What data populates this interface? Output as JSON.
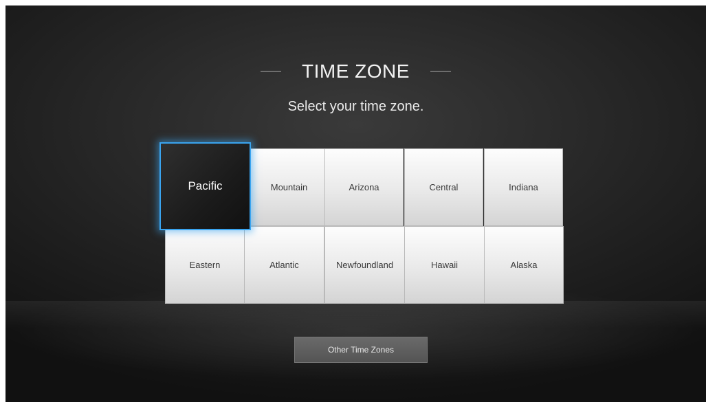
{
  "screen": {
    "title": "TIME ZONE",
    "subtitle": "Select your time zone."
  },
  "time_zones": [
    {
      "label": "Pacific",
      "selected": true
    },
    {
      "label": "Mountain",
      "selected": false
    },
    {
      "label": "Arizona",
      "selected": false
    },
    {
      "label": "Central",
      "selected": false
    },
    {
      "label": "Indiana",
      "selected": false
    },
    {
      "label": "Eastern",
      "selected": false
    },
    {
      "label": "Atlantic",
      "selected": false
    },
    {
      "label": "Newfoundland",
      "selected": false
    },
    {
      "label": "Hawaii",
      "selected": false
    },
    {
      "label": "Alaska",
      "selected": false
    }
  ],
  "other_button": {
    "label": "Other Time Zones"
  },
  "colors": {
    "focus_highlight": "#3aa4ef",
    "background": "#232323",
    "tile": "#e9e9e9"
  }
}
